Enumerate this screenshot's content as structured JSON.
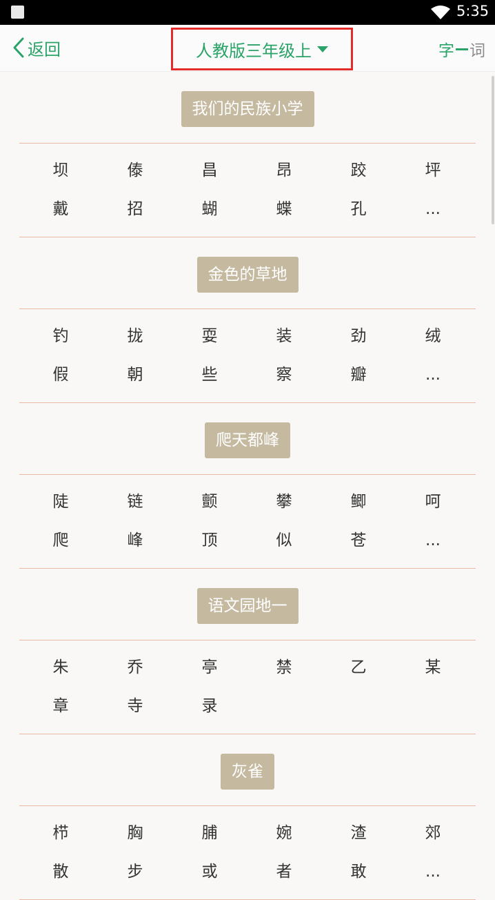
{
  "status_bar": {
    "time": "5:35"
  },
  "header": {
    "back_label": "返回",
    "title": "人教版三年级上",
    "mode_zi": "字",
    "mode_ci": "词"
  },
  "lessons": [
    {
      "title": "我们的民族小学",
      "chars": [
        "坝",
        "傣",
        "昌",
        "昂",
        "跤",
        "坪",
        "戴",
        "招",
        "蝴",
        "蝶",
        "孔",
        "..."
      ]
    },
    {
      "title": "金色的草地",
      "chars": [
        "钓",
        "拢",
        "耍",
        "装",
        "劲",
        "绒",
        "假",
        "朝",
        "些",
        "察",
        "瓣",
        "..."
      ]
    },
    {
      "title": "爬天都峰",
      "chars": [
        "陡",
        "链",
        "颤",
        "攀",
        "鲫",
        "呵",
        "爬",
        "峰",
        "顶",
        "似",
        "苍",
        "..."
      ]
    },
    {
      "title": "语文园地一",
      "chars": [
        "朱",
        "乔",
        "亭",
        "禁",
        "乙",
        "某",
        "章",
        "寺",
        "录"
      ]
    },
    {
      "title": "灰雀",
      "chars": [
        "栉",
        "胸",
        "脯",
        "婉",
        "渣",
        "郊",
        "散",
        "步",
        "或",
        "者",
        "敢",
        "..."
      ]
    }
  ]
}
